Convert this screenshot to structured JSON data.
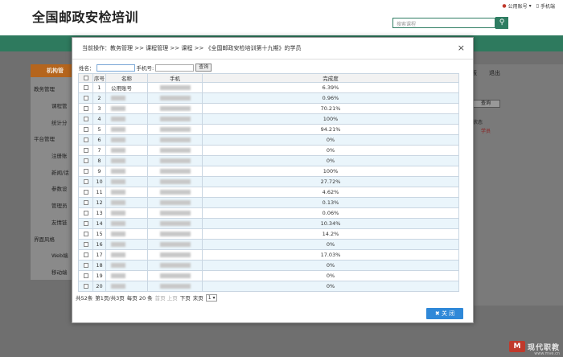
{
  "site": {
    "title": "全国邮政安检培训",
    "account_link": "公用账号",
    "mobile_link": "手机端",
    "search_placeholder": "搜索课程"
  },
  "sidebar": {
    "header": "机构管",
    "items": [
      {
        "label": "教务管理"
      },
      {
        "label": "课程管"
      },
      {
        "label": "统计分"
      },
      {
        "label": "平台管理"
      },
      {
        "label": "注册账"
      },
      {
        "label": "新闻/话"
      },
      {
        "label": "参数设"
      },
      {
        "label": "管理员"
      },
      {
        "label": "友情链"
      },
      {
        "label": "界面风格"
      },
      {
        "label": "Web端"
      },
      {
        "label": "移动端"
      }
    ]
  },
  "right_panel": {
    "tab1": "板",
    "tab2": "退出",
    "query_btn": "查询",
    "status_col": "状态",
    "action_text": "学员"
  },
  "modal": {
    "breadcrumb": "当前操作：教务管理 >> 课程管理 >> 课程 >> 《全国邮政安检培训第十九期》的学员",
    "close_icon": "×",
    "filter": {
      "name_label": "姓名：",
      "phone_label": "手机号:",
      "query_btn": "查询"
    },
    "table": {
      "headers": [
        "",
        "序号",
        "名称",
        "手机",
        "完成度"
      ],
      "rows": [
        {
          "no": "1",
          "name": "公用账号",
          "progress": "6.39%"
        },
        {
          "no": "2",
          "name": "",
          "progress": "0.96%"
        },
        {
          "no": "3",
          "name": "",
          "progress": "70.21%"
        },
        {
          "no": "4",
          "name": "",
          "progress": "100%"
        },
        {
          "no": "5",
          "name": "",
          "progress": "94.21%"
        },
        {
          "no": "6",
          "name": "",
          "progress": "0%"
        },
        {
          "no": "7",
          "name": "",
          "progress": "0%"
        },
        {
          "no": "8",
          "name": "",
          "progress": "0%"
        },
        {
          "no": "9",
          "name": "",
          "progress": "100%"
        },
        {
          "no": "10",
          "name": "",
          "progress": "27.72%"
        },
        {
          "no": "11",
          "name": "",
          "progress": "4.62%"
        },
        {
          "no": "12",
          "name": "",
          "progress": "0.13%"
        },
        {
          "no": "13",
          "name": "",
          "progress": "0.06%"
        },
        {
          "no": "14",
          "name": "",
          "progress": "10.34%"
        },
        {
          "no": "15",
          "name": "",
          "progress": "14.2%"
        },
        {
          "no": "16",
          "name": "",
          "progress": "0%"
        },
        {
          "no": "17",
          "name": "",
          "progress": "17.03%"
        },
        {
          "no": "18",
          "name": "",
          "progress": "0%"
        },
        {
          "no": "19",
          "name": "",
          "progress": "0%"
        },
        {
          "no": "20",
          "name": "",
          "progress": "0%"
        }
      ]
    },
    "footer": {
      "total": "共52条",
      "page_info": "第1页/共3页",
      "per_page": "每页 20 条",
      "first_prev": "首页 上页",
      "next": "下页",
      "last": "末页",
      "page_select": "1"
    },
    "close_btn": "关 闭"
  },
  "watermark": {
    "logo": "M",
    "text": "现代职教",
    "url": "www.mve.cn"
  }
}
